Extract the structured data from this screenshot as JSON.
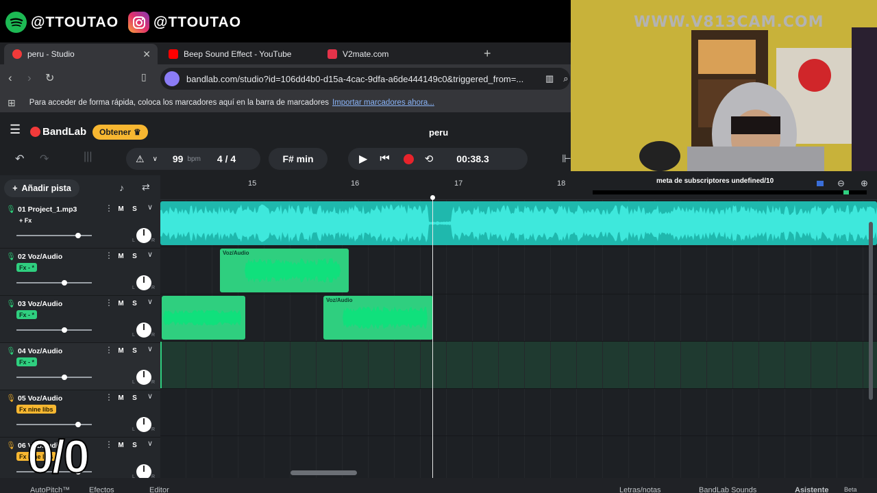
{
  "overlay": {
    "spotify_handle": "@TTOUTAO",
    "instagram_handle": "@TTOUTAO",
    "webcam_watermark": "WWW.V813CAM.COM",
    "counter": "0/0",
    "subs_goal": "meta de subscriptores undefined/10"
  },
  "browser": {
    "tabs": [
      {
        "label": "peru - Studio",
        "active": true
      },
      {
        "label": "Beep Sound Effect - YouTube",
        "active": false
      },
      {
        "label": "V2mate.com",
        "active": false
      }
    ],
    "url": "bandlab.com/studio?id=106dd4b0-d15a-4cac-9dfa-a6de444149c0&triggered_from=...",
    "bookmarks_hint": "Para acceder de forma rápida, coloca los marcadores aquí en la barra de marcadores",
    "bookmarks_link": "Importar marcadores ahora..."
  },
  "app": {
    "brand": "BandLab",
    "upgrade_label": "Obtener",
    "project_title": "peru",
    "bpm": "99",
    "bpm_unit": "bpm",
    "time_signature": "4 / 4",
    "key": "F# min",
    "time": "00:38.3",
    "add_track_label": "Añadir pista",
    "ruler_bars": [
      "15",
      "16",
      "17",
      "18"
    ],
    "tracks": [
      {
        "name": "01  Project_1.mp3",
        "fx": "+ Fx",
        "fx_style": "plain",
        "vol": 0.82,
        "mic_color": "#2dd07a"
      },
      {
        "name": "02  Voz/Audio",
        "fx": "Fx - *",
        "fx_style": "green",
        "vol": 0.64,
        "mic_color": "#2dd07a"
      },
      {
        "name": "03  Voz/Audio",
        "fx": "Fx - *",
        "fx_style": "green",
        "vol": 0.64,
        "mic_color": "#2dd07a"
      },
      {
        "name": "04  Voz/Audio",
        "fx": "Fx - *",
        "fx_style": "green",
        "vol": 0.64,
        "mic_color": "#2dd07a"
      },
      {
        "name": "05  Voz/Audio",
        "fx": "Fx nine libs",
        "fx_style": "yellow",
        "vol": 0.82,
        "mic_color": "#e8a92a"
      },
      {
        "name": "06  Voz/Audio",
        "fx": "Fx nine libs",
        "fx_style": "yellow",
        "vol": 0.82,
        "mic_color": "#e8a92a"
      }
    ],
    "mute_label": "M",
    "solo_label": "S",
    "region_label": "Voz/Audio",
    "bottom": {
      "autopitch": "AutoPitch™",
      "effects": "Efectos",
      "editor": "Editor",
      "lyrics": "Letras/notas",
      "sounds": "BandLab Sounds",
      "assistant": "Asistente",
      "beta": "Beta"
    }
  },
  "colors": {
    "accent_teal": "#1fd0c4",
    "accent_green": "#2fcf7f",
    "brand_red": "#f23a3a",
    "record_red": "#e8232b",
    "upgrade_yellow": "#f7b731"
  }
}
